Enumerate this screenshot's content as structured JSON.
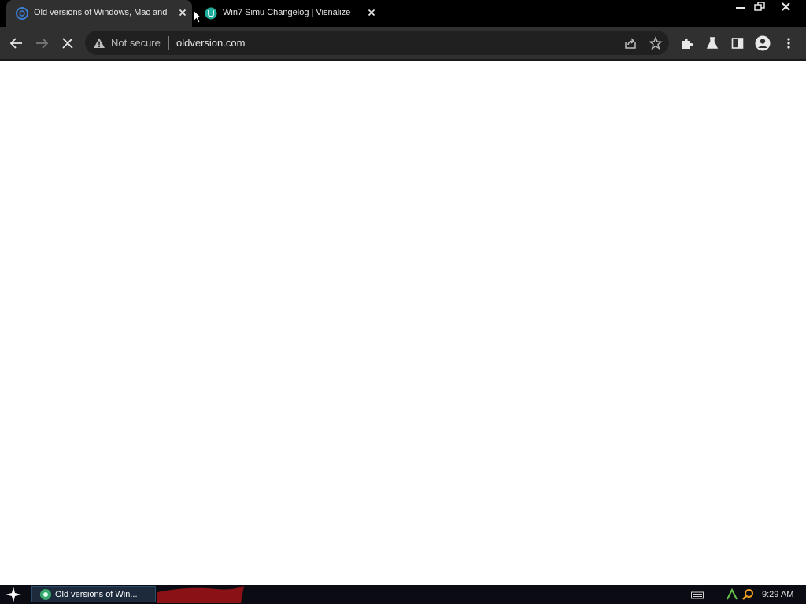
{
  "tabs": [
    {
      "title": "Old versions of Windows, Mac and L",
      "active": true,
      "favicon": "oldversion-favicon-icon"
    },
    {
      "title": "Win7 Simu Changelog | Visnalize",
      "active": false,
      "favicon": "visnalize-favicon-icon"
    }
  ],
  "address_bar": {
    "security_text": "Not secure",
    "url": "oldversion.com"
  },
  "taskbar": {
    "window_button_label": "Old versions of Win...",
    "clock": "9:29 AM"
  },
  "colors": {
    "frame": "#000000",
    "toolbar": "#303030",
    "omnibox": "#202020",
    "page": "#ffffff",
    "taskbar": "#0b0b14"
  }
}
